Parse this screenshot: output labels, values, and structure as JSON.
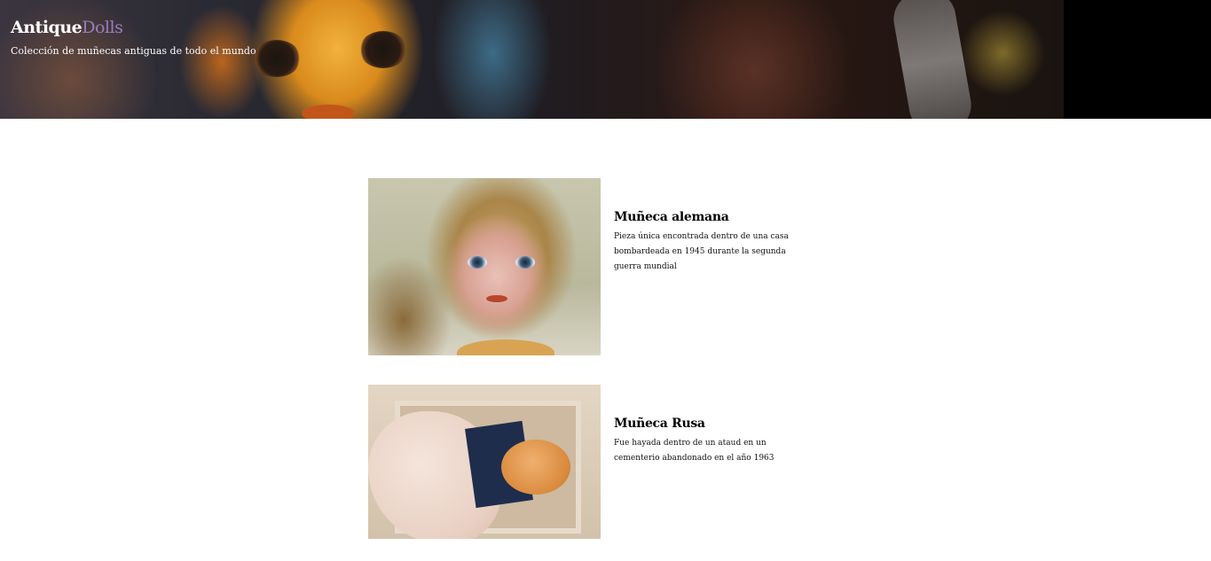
{
  "header": {
    "brand_part1": "Antique",
    "brand_part2": "Dolls",
    "tagline": "Colección de muñecas antiguas de todo el mundo"
  },
  "dolls": [
    {
      "title": "Muñeca alemana",
      "description": "Pieza única encontrada dentro de una casa bombardeada en 1945 durante la segunda guerra mundial",
      "image_alt": "Muñeca alemana"
    },
    {
      "title": "Muñeca Rusa",
      "description": "Fue hayada dentro de un ataud en un cementerio abandonado en el año 1963",
      "image_alt": "Muñeca Rusa"
    }
  ],
  "colors": {
    "brand_accent": "#9b7cc0",
    "header_bg": "#000000",
    "page_bg": "#ffffff"
  }
}
